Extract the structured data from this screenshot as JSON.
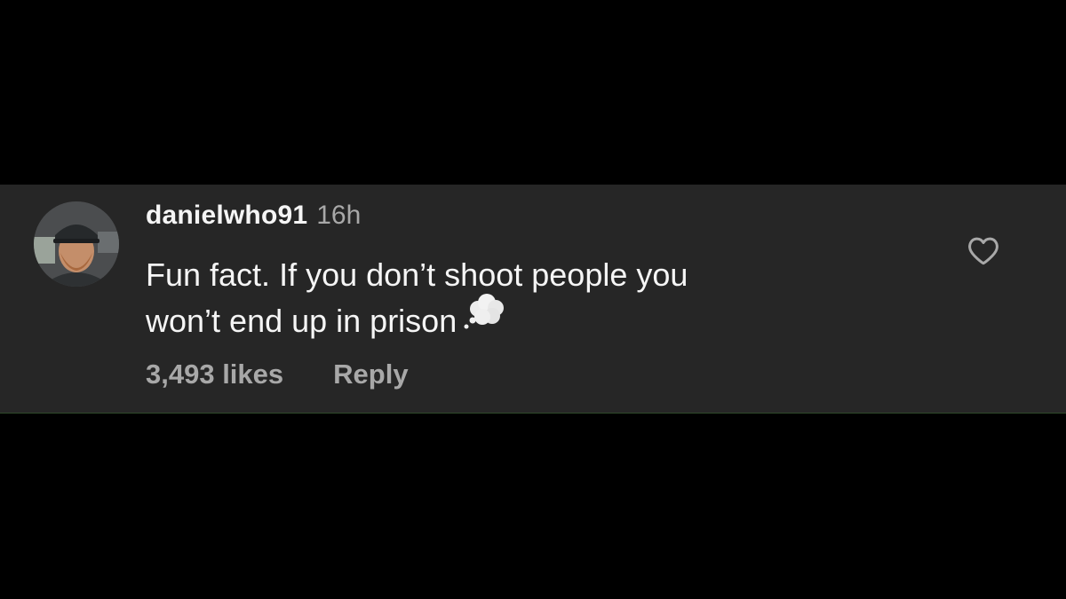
{
  "comment": {
    "username": "danielwho91",
    "timestamp": "16h",
    "text_lines": [
      "Fun fact. If you don’t shoot people you",
      "won’t end up in prison"
    ],
    "emoji": "thought-balloon",
    "likes": "3,493 likes",
    "reply_label": "Reply",
    "like_icon": "heart-outline-icon",
    "avatar": "user-avatar-photo"
  },
  "colors": {
    "page_background": "#000000",
    "card_background": "#262626",
    "primary_text": "#f5f5f5",
    "secondary_text": "#a8a8a8"
  }
}
